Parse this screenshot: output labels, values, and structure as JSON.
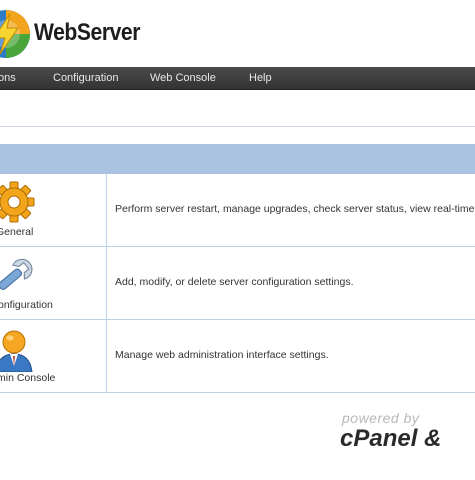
{
  "app": {
    "title": "WebServer",
    "brand_colors": {
      "logo_green": "#4aa53b",
      "logo_orange": "#f2a41b",
      "logo_blue": "#2d7dc6"
    }
  },
  "nav": {
    "items": [
      {
        "label": "ons",
        "icon": "none"
      },
      {
        "label": "Configuration"
      },
      {
        "label": "Web Console"
      },
      {
        "label": "Help"
      }
    ]
  },
  "table": {
    "header_color": "#a9c3e0",
    "rows": [
      {
        "label": "General",
        "icon": "gear-icon",
        "description": "Perform server restart, manage upgrades, check server status, view real-time s"
      },
      {
        "label": "onfiguration",
        "icon": "wrench-icon",
        "description": "Add, modify, or delete server configuration settings."
      },
      {
        "label": "min Console",
        "icon": "admin-user-icon",
        "description": "Manage web administration interface settings."
      }
    ]
  },
  "footer": {
    "powered_by": "powered by",
    "brand": "cPanel &"
  }
}
